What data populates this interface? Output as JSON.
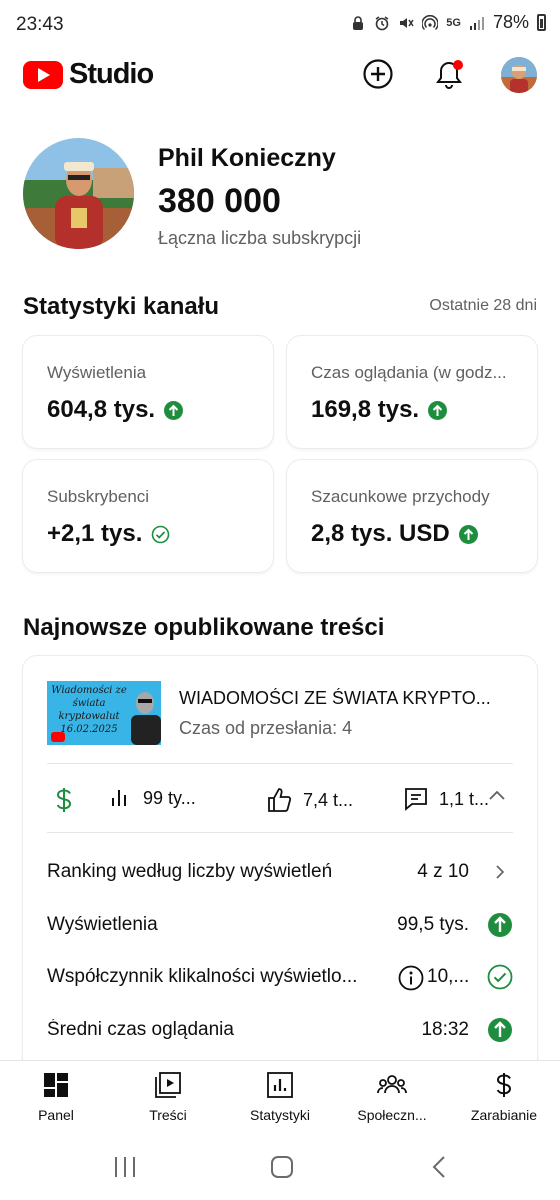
{
  "status_bar": {
    "time": "23:43",
    "network": "5G",
    "battery": "78%"
  },
  "header": {
    "app_name": "Studio",
    "brand_color": "#ff0000",
    "icons": [
      "add-icon",
      "notifications-icon",
      "account-avatar"
    ],
    "notification_dot_color": "#ff0000"
  },
  "channel": {
    "name": "Phil Konieczny",
    "subscribers": "380 000",
    "subscribers_label": "Łączna liczba subskrypcji"
  },
  "stats": {
    "title": "Statystyki kanału",
    "period": "Ostatnie 28 dni",
    "cards": [
      {
        "label": "Wyświetlenia",
        "value": "604,8 tys.",
        "indicator": "up-arrow"
      },
      {
        "label": "Czas oglądania (w godz...",
        "value": "169,8 tys.",
        "indicator": "up-arrow"
      },
      {
        "label": "Subskrybenci",
        "value": "+2,1 tys.",
        "indicator": "check"
      },
      {
        "label": "Szacunkowe przychody",
        "value": "2,8 tys. USD",
        "indicator": "up-arrow"
      }
    ],
    "indicator_color": "#1e8e3e"
  },
  "latest": {
    "title": "Najnowsze opublikowane treści",
    "thumbnail_text": "Wiadomości ze świata kryptowalut 16.02.2025",
    "video_title": "WIADOMOŚCI ZE ŚWIATA KRYPTO...",
    "video_age": "Czas od przesłania: 4",
    "metrics": {
      "views": "99 ty...",
      "likes": "7,4 t...",
      "comments": "1,1 t..."
    },
    "details": [
      {
        "label": "Ranking według liczby wyświetleń",
        "value": "4 z 10",
        "icon": "chevron-right-icon"
      },
      {
        "label": "Wyświetlenia",
        "value": "99,5 tys.",
        "icon": "up-arrow"
      },
      {
        "label": "Współczynnik klikalności wyświetlo...",
        "value": "10,...",
        "icon": "check"
      },
      {
        "label": "Średni czas oglądania",
        "value": "18:32",
        "icon": "up-arrow"
      }
    ]
  },
  "bottom_nav": [
    {
      "label": "Panel",
      "icon": "dashboard-icon"
    },
    {
      "label": "Treści",
      "icon": "content-icon"
    },
    {
      "label": "Statystyki",
      "icon": "analytics-icon"
    },
    {
      "label": "Społeczn...",
      "icon": "community-icon"
    },
    {
      "label": "Zarabianie",
      "icon": "earn-icon"
    }
  ],
  "system_nav": [
    "recents-icon",
    "home-icon",
    "back-icon"
  ]
}
